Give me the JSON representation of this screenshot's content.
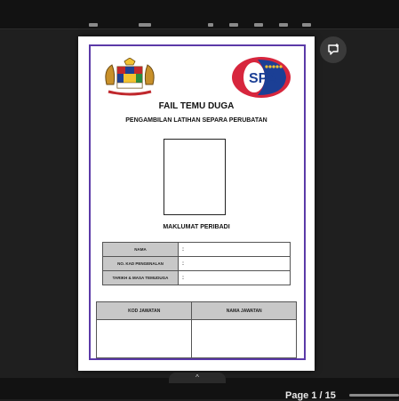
{
  "document": {
    "title": "FAIL TEMU DUGA",
    "subtitle": "PENGAMBILAN LATIHAN SEPARA PERUBATAN",
    "section_title": "MAKLUMAT PERIBADI",
    "info_rows": [
      {
        "label": "NAMA",
        "value": ":"
      },
      {
        "label": "NO. KAD PENGENALAN",
        "value": ":"
      },
      {
        "label": "TARIKH & MASA TEMUDUGA",
        "value": ":"
      }
    ],
    "job_headers": [
      "KOD JAWATAN",
      "NAMA JAWATAN"
    ],
    "logo_text": "SPA"
  },
  "toolbar": {
    "expand_glyph": "^"
  },
  "footer": {
    "page_indicator": "Page 1 / 15"
  },
  "colors": {
    "frame": "#5b3aa8",
    "header_cell": "#c8c8c8",
    "spa_red": "#d7263d",
    "spa_blue": "#1b3f95"
  }
}
